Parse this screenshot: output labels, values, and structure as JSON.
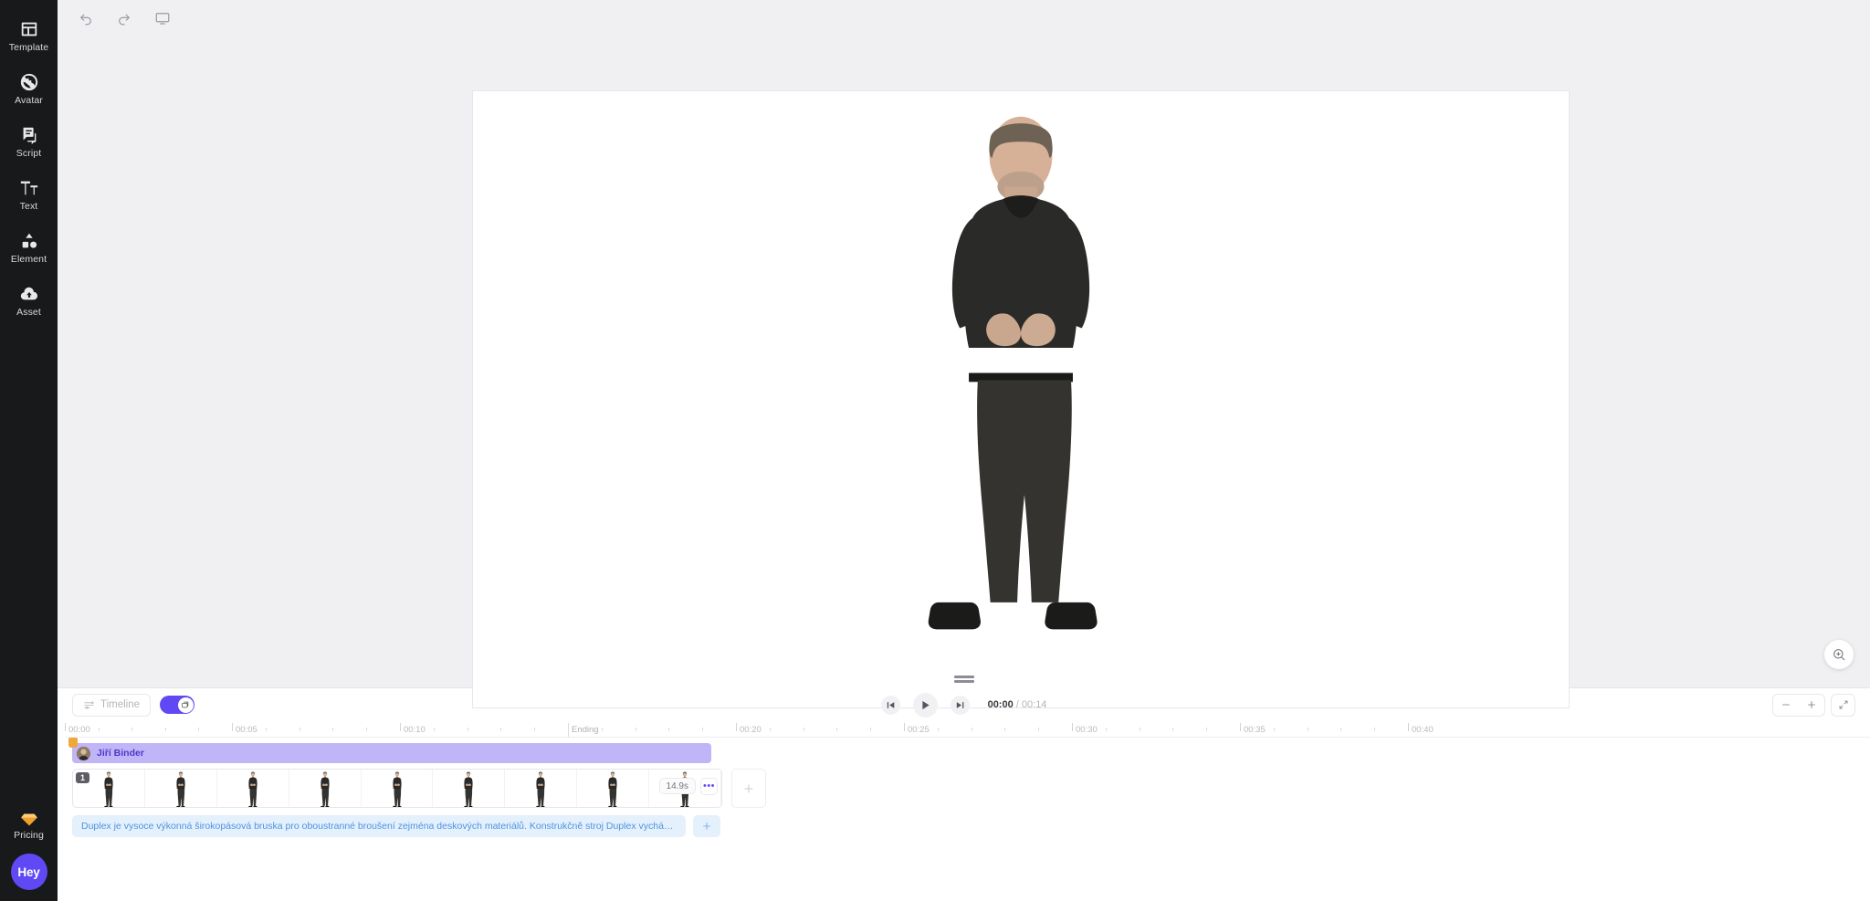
{
  "sidebar": {
    "items": [
      {
        "label": "Template",
        "icon": "template-icon"
      },
      {
        "label": "Avatar",
        "icon": "avatar-icon"
      },
      {
        "label": "Script",
        "icon": "script-icon"
      },
      {
        "label": "Text",
        "icon": "text-icon"
      },
      {
        "label": "Element",
        "icon": "element-icon"
      },
      {
        "label": "Asset",
        "icon": "asset-cloud-icon"
      }
    ],
    "pricing": {
      "label": "Pricing",
      "icon": "diamond-icon",
      "color": "#f5a623"
    },
    "hey_button": {
      "label": "Hey",
      "color": "#6049f5"
    }
  },
  "toolbar": {
    "undo": "undo-icon",
    "redo": "redo-icon",
    "display": "monitor-icon"
  },
  "canvas": {
    "background": "#ffffff",
    "zoom_button": "zoom-in-icon"
  },
  "timeline": {
    "timeline_button_label": "Timeline",
    "toggle_on": true,
    "toggle_color": "#6049f5",
    "playhead_color": "#f0a73b",
    "playback": {
      "skip_start": "skip-to-start-icon",
      "play": "play-icon",
      "skip_end": "skip-to-end-icon",
      "current_time": "00:00",
      "separator": "/",
      "total_time": "00:14"
    },
    "zoom_out_label": "−",
    "zoom_in_label": "+",
    "fit_label": "collapse-icon",
    "ruler": {
      "marks": [
        {
          "label": "00:00",
          "pos": 0
        },
        {
          "label": "00:05",
          "pos": 183
        },
        {
          "label": "00:10",
          "pos": 367
        },
        {
          "label": "Ending",
          "pos": 551
        },
        {
          "label": "00:20",
          "pos": 735
        },
        {
          "label": "00:25",
          "pos": 919
        },
        {
          "label": "00:30",
          "pos": 1103
        },
        {
          "label": "00:35",
          "pos": 1287
        },
        {
          "label": "00:40",
          "pos": 1471
        }
      ]
    },
    "avatar_track": {
      "name": "Jiří Binder"
    },
    "clip": {
      "index_badge": "1",
      "duration": "14.9s",
      "menu_label": "•••",
      "frame_count": 9,
      "add_label": "+"
    },
    "script_track": {
      "text": "Duplex je vysoce výkonná širokopásová bruska pro oboustranné broušení zejména deskových materiálů. Konstrukčně stroj Duplex vychází z řady ...",
      "add_label": "+"
    }
  }
}
